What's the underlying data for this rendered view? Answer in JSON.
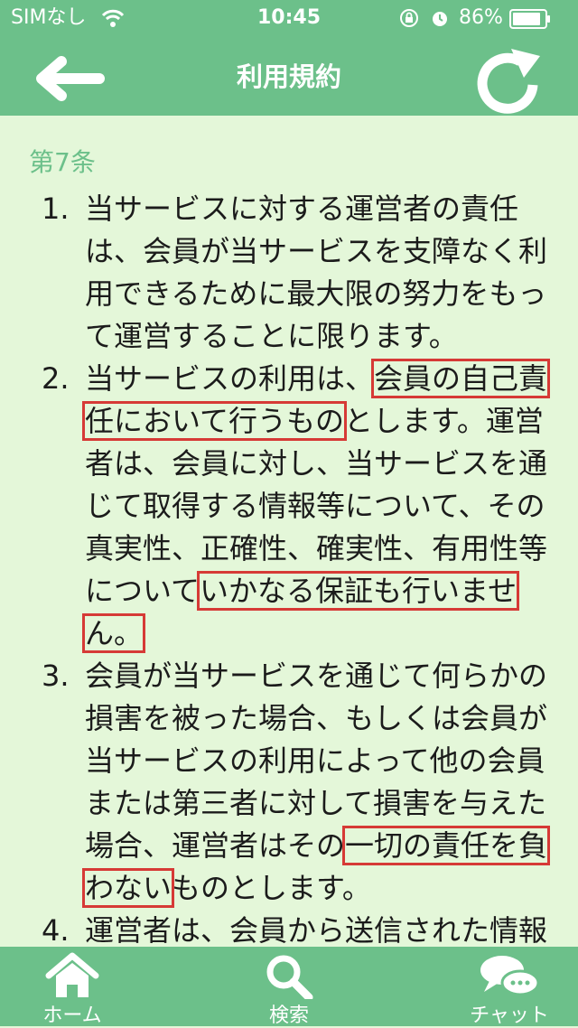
{
  "status_bar": {
    "carrier": "SIMなし",
    "time": "10:45",
    "battery_percent": "86%"
  },
  "nav": {
    "title": "利用規約",
    "back_icon": "arrow-left-icon",
    "refresh_icon": "refresh-icon"
  },
  "content": {
    "article": "第7条",
    "items": [
      {
        "num": "1.",
        "segments": [
          {
            "text": "当サービスに対する運営者の責任は、会員が当サービスを支障なく利用できるために最大限の努力をもって運営することに限ります。",
            "hl": false
          }
        ]
      },
      {
        "num": "2.",
        "segments": [
          {
            "text": "当サービスの利用は、",
            "hl": false
          },
          {
            "text": "会員の自己責任において行うもの",
            "hl": true
          },
          {
            "text": "とします。運営者は、会員に対し、当サービスを通じて取得する情報等について、その真実性、正確性、確実性、有用性等について",
            "hl": false
          },
          {
            "text": "いかなる保証も行いません。",
            "hl": true
          }
        ]
      },
      {
        "num": "3.",
        "segments": [
          {
            "text": "会員が当サービスを通じて何らかの損害を被った場合、もしくは会員が当サービスの利用によって他の会員または第三者に対して損害を与えた場合、運営者はその",
            "hl": false
          },
          {
            "text": "一切の責任を負わない",
            "hl": true
          },
          {
            "text": "ものとします。",
            "hl": false
          }
        ]
      },
      {
        "num": "4.",
        "segments": [
          {
            "text": "運営者は、会員から送信された情報について適宜その内容の掲載可否を",
            "hl": false
          }
        ]
      }
    ],
    "highlight_color": "#d63a36"
  },
  "tab_bar": {
    "tabs": [
      {
        "label": "ホーム",
        "icon": "home-icon"
      },
      {
        "label": "検索",
        "icon": "search-icon"
      },
      {
        "label": "チャット",
        "icon": "chat-icon"
      }
    ]
  },
  "colors": {
    "accent": "#6cc08a",
    "background": "#e4f7d9",
    "text": "#1b1b1b"
  }
}
